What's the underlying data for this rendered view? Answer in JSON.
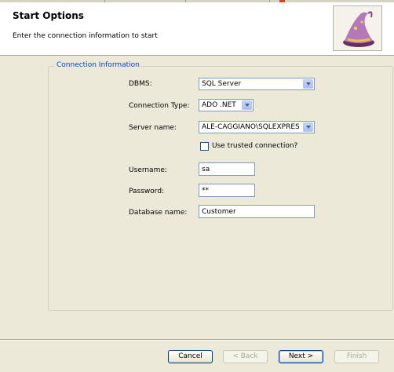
{
  "header": {
    "title": "Start Options",
    "subtitle": "Enter the connection information to start"
  },
  "group": {
    "legend": "Connection Information"
  },
  "form": {
    "dbms": {
      "label": "DBMS:",
      "value": "SQL Server"
    },
    "connection_type": {
      "label": "Connection Type:",
      "value": "ADO .NET"
    },
    "server_name": {
      "label": "Server name:",
      "value": "ALE-CAGGIANO\\SQLEXPRES"
    },
    "trusted": {
      "label": "Use trusted connection?",
      "checked": false
    },
    "username": {
      "label": "Username:",
      "value": "sa"
    },
    "password": {
      "label": "Password:",
      "value": "**"
    },
    "database": {
      "label": "Database name:",
      "value": "Customer"
    }
  },
  "buttons": {
    "cancel": "Cancel",
    "back": "< Back",
    "next": "Next >",
    "finish": "Finish"
  },
  "icons": {
    "header_image": "wizard-hat-icon"
  },
  "colors": {
    "legend": "#0046d5",
    "background": "#ece9d8"
  }
}
